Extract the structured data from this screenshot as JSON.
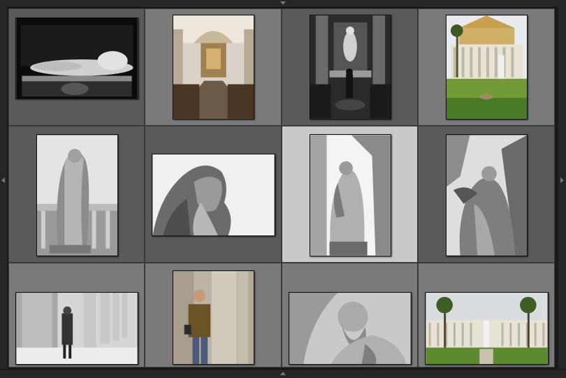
{
  "app": {
    "view": "grid-view"
  },
  "photos": [
    {
      "subject": "recumbent-marble-statue",
      "colors": [
        "#0e0e0e",
        "#d8d8d8"
      ]
    },
    {
      "subject": "church-nave-interior",
      "colors": [
        "#5a4a3a",
        "#caa878"
      ]
    },
    {
      "subject": "chapel-altar-with-visitor",
      "colors": [
        "#222",
        "#9a9a9a"
      ]
    },
    {
      "subject": "basilica-facade-with-garden",
      "colors": [
        "#6a8a3a",
        "#e9e6dc"
      ]
    },
    {
      "subject": "robed-statue-full-figure",
      "colors": [
        "#e8e8e8",
        "#777"
      ]
    },
    {
      "subject": "bearded-statue-profile",
      "colors": [
        "#f2f2f2",
        "#555"
      ]
    },
    {
      "subject": "statue-under-arch-low-angle",
      "colors": [
        "#eee",
        "#777"
      ]
    },
    {
      "subject": "statue-against-sky-low-angle",
      "colors": [
        "#ddd",
        "#555"
      ]
    },
    {
      "subject": "woman-between-columns",
      "colors": [
        "#cfcfcf",
        "#333"
      ]
    },
    {
      "subject": "man-leaning-on-column",
      "colors": [
        "#b9a88a",
        "#5e4a26"
      ]
    },
    {
      "subject": "bearded-statue-head-closeup",
      "colors": [
        "#bbb",
        "#555"
      ]
    },
    {
      "subject": "colonnade-garden-with-palms",
      "colors": [
        "#4f7a2f",
        "#e0ddd2"
      ]
    }
  ],
  "selection": {
    "selected_index": 6
  }
}
